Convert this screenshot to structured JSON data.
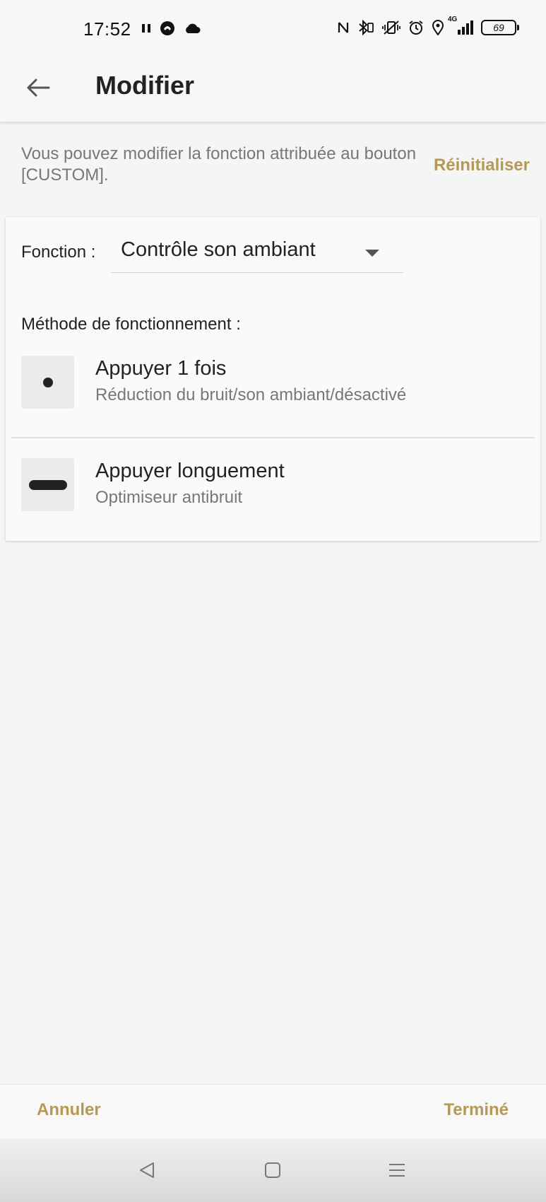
{
  "status_bar": {
    "time": "17:52",
    "left_icons": [
      "pause-icon",
      "app-circle-icon",
      "cloud-icon"
    ],
    "right_icons": [
      "nfc-icon",
      "bluetooth-icon",
      "vibrate-icon",
      "alarm-icon",
      "location-icon",
      "signal-icon"
    ],
    "network_label": "4G",
    "battery_level": "69"
  },
  "app_bar": {
    "back_icon": "arrow-left-icon",
    "title": "Modifier"
  },
  "description": {
    "text": "Vous pouvez modifier la fonction attribuée au bouton [CUSTOM].",
    "reset_label": "Réinitialiser"
  },
  "function": {
    "label": "Fonction :",
    "value": "Contrôle son ambiant"
  },
  "method": {
    "label": "Méthode de fonctionnement :",
    "items": [
      {
        "icon": "single-tap-dot-icon",
        "title": "Appuyer 1 fois",
        "subtitle": "Réduction du bruit/son ambiant/désactivé"
      },
      {
        "icon": "long-press-dash-icon",
        "title": "Appuyer longuement",
        "subtitle": "Optimiseur antibruit"
      }
    ]
  },
  "actions": {
    "cancel_label": "Annuler",
    "done_label": "Terminé"
  },
  "nav_bar": {
    "icons": [
      "nav-back-icon",
      "nav-home-icon",
      "nav-menu-icon"
    ]
  },
  "colors": {
    "accent": "#b59a55",
    "background": "#f5f5f5",
    "card": "#fafafa",
    "text_primary": "#222222",
    "text_secondary": "#777777"
  }
}
